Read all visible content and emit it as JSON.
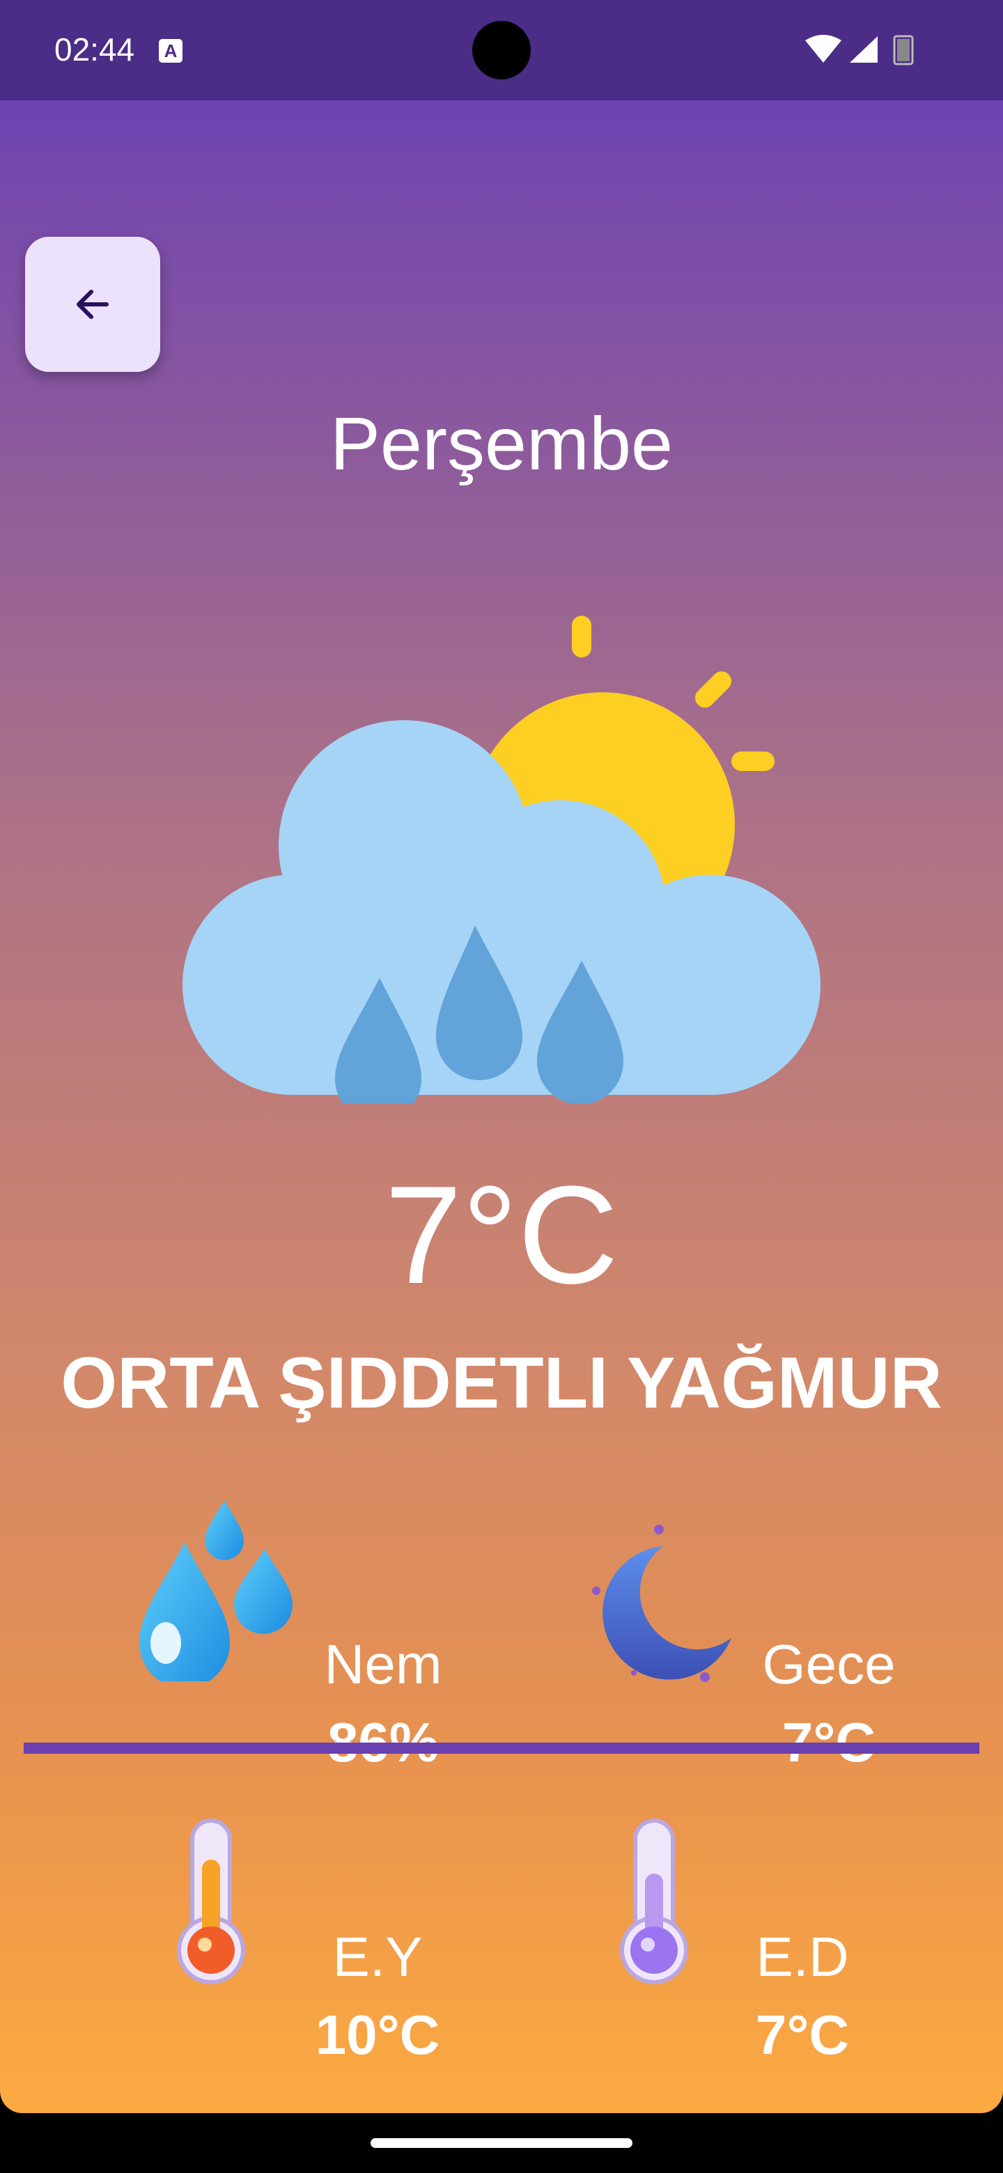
{
  "status_bar": {
    "time": "02:44",
    "notification_icon": "a-icon"
  },
  "header": {
    "back_icon": "arrow-left-icon"
  },
  "day": "Perşembe",
  "weather": {
    "icon": "sun-cloud-rain-icon",
    "temperature": "7°C",
    "description": "ORTA ŞIDDETLI YAĞMUR"
  },
  "stats": {
    "humidity": {
      "label": "Nem",
      "value": "86%",
      "icon": "water-drops-icon"
    },
    "night": {
      "label": "Gece",
      "value": "7°C",
      "icon": "moon-icon"
    },
    "max": {
      "label": "E.Y",
      "value": "10°C",
      "icon": "thermometer-hot-icon"
    },
    "min": {
      "label": "E.D",
      "value": "7°C",
      "icon": "thermometer-cold-icon"
    }
  },
  "colors": {
    "status_bar": "#4B2C86",
    "gradient_top": "#6E43B1",
    "gradient_bottom": "#FCAA41",
    "divider": "#6A3FB0",
    "back_button_bg": "#EDE2FB"
  }
}
